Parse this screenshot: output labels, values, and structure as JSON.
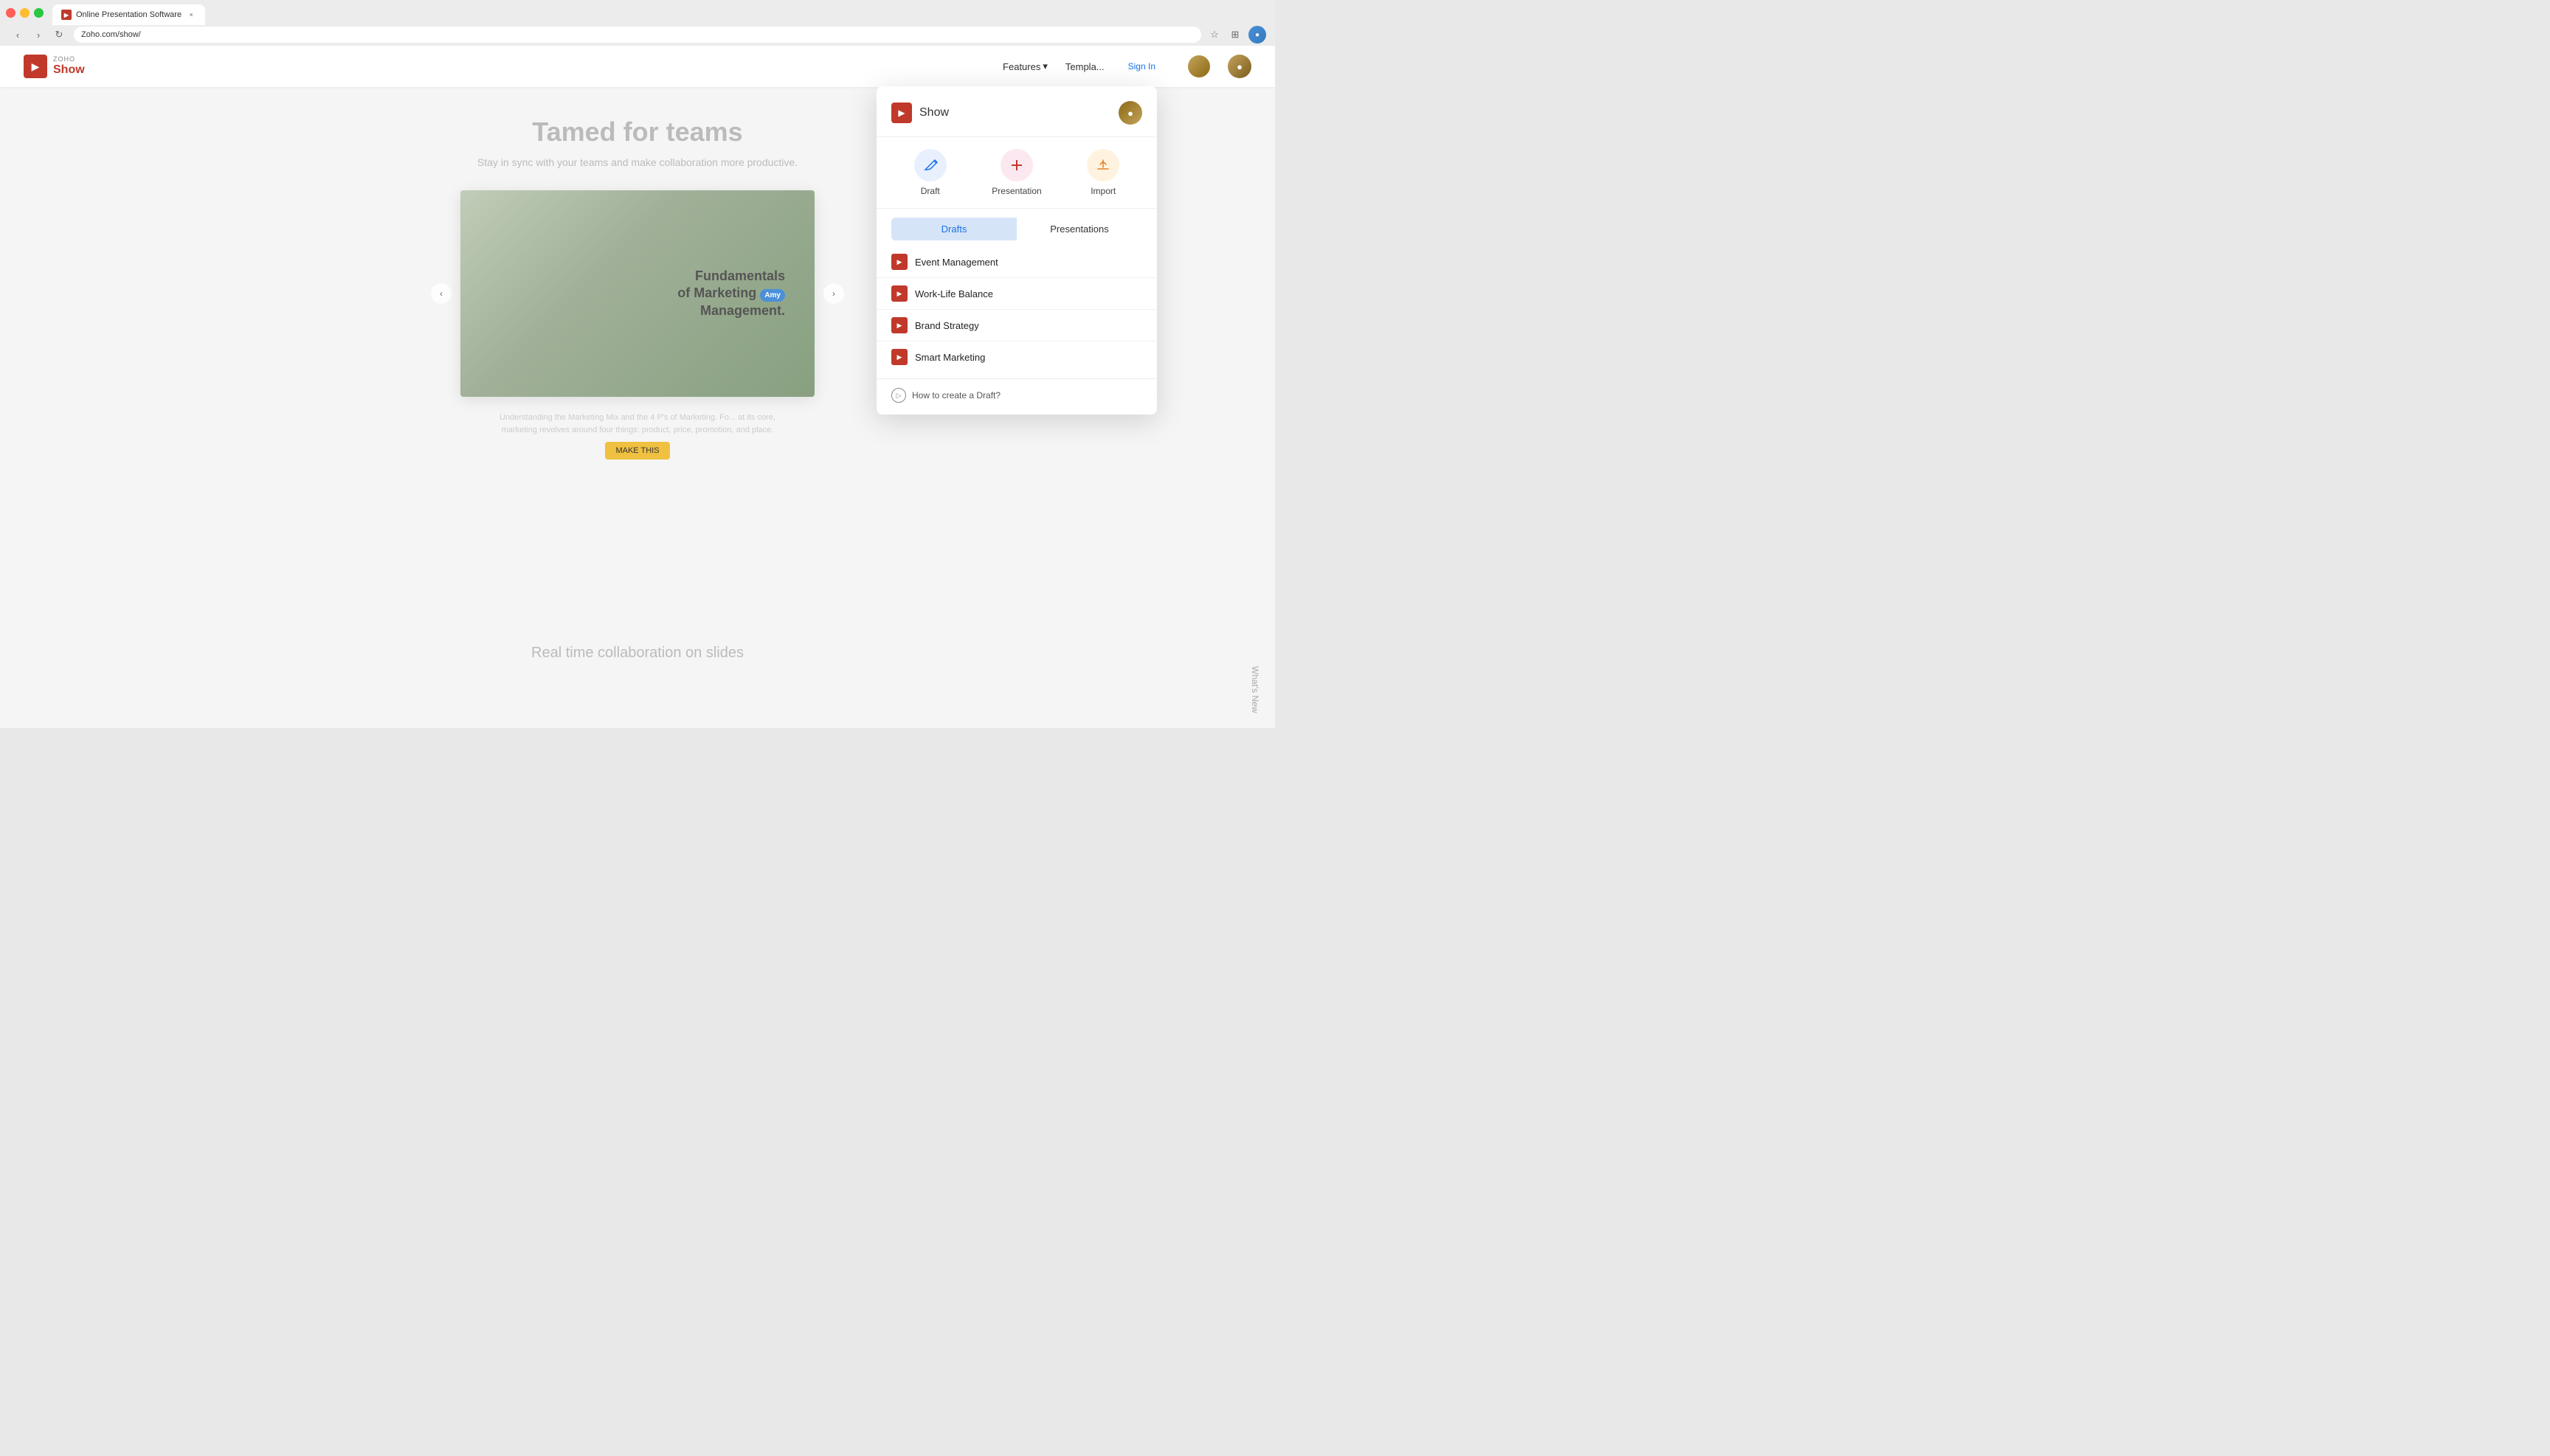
{
  "browser": {
    "tab_title": "Online Presentation Software",
    "tab_favicon": "▶",
    "url": "Zoho.com/show/",
    "close_icon": "×",
    "back_icon": "‹",
    "forward_icon": "›",
    "reload_icon": "↻",
    "star_icon": "☆",
    "extensions_icon": "⊞",
    "profile_icon": "●"
  },
  "site": {
    "logo_zoho": "Zoho",
    "logo_show": "Show",
    "nav_features": "Features",
    "nav_features_arrow": "▾",
    "nav_templates": "Templa...",
    "hero_title": "Tamed for teams",
    "hero_subtitle": "Stay in sync with your teams and make collaboration more productive.",
    "slide_title_line1": "Fundamentals",
    "slide_title_line2": "of Marketing",
    "slide_title_line3": "Management.",
    "collab_label": "Amy",
    "marketing_text": "Understanding the Marketing Mix and the 4 P's of Marketing. Fo... at its core, marketing revolves around four things: product, price, promotion, and place.",
    "cta_label": "MAKE THIS",
    "bottom_title": "Real time collaboration on slides",
    "whats_new": "What's New"
  },
  "panel": {
    "title": "Show",
    "logo_icon": "▶",
    "draft_label": "Draft",
    "presentation_label": "Presentation",
    "import_label": "Import",
    "draft_icon": "✎",
    "presentation_icon": "+",
    "import_icon": "↑",
    "tab_drafts": "Drafts",
    "tab_presentations": "Presentations",
    "items": [
      {
        "name": "Event Management"
      },
      {
        "name": "Work-Life Balance"
      },
      {
        "name": "Brand Strategy"
      },
      {
        "name": "Smart Marketing"
      }
    ],
    "how_to_label": "How to create a Draft?",
    "item_icon": "▶",
    "play_icon": "▷"
  }
}
